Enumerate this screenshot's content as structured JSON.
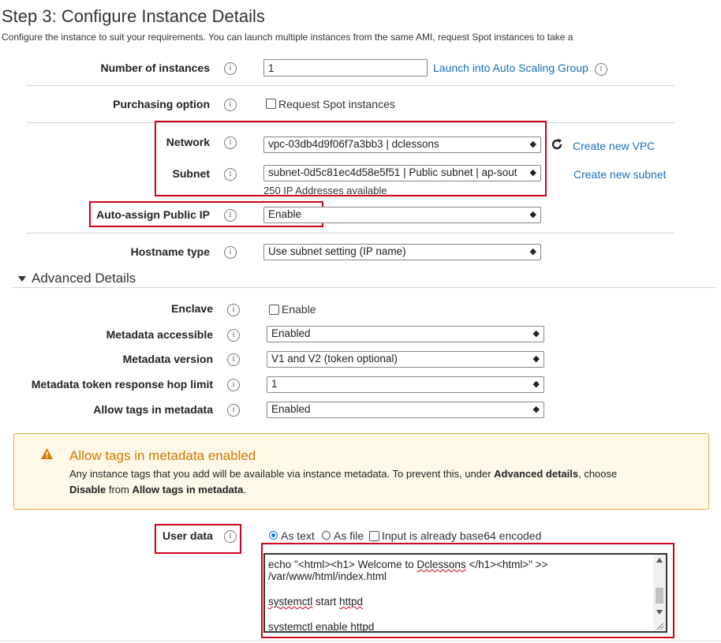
{
  "page": {
    "title": "Step 3: Configure Instance Details",
    "subtitle": "Configure the instance to suit your requirements. You can launch multiple instances from the same AMI, request Spot instances to take a"
  },
  "info_glyph": "i",
  "select_arrow_glyph": "◆",
  "fields": {
    "number_of_instances": {
      "label": "Number of instances",
      "value": "1",
      "link": "Launch into Auto Scaling Group"
    },
    "purchasing_option": {
      "label": "Purchasing option",
      "checkbox_label": "Request Spot instances"
    },
    "network": {
      "label": "Network",
      "value": "vpc-03db4d9f06f7a3bb3 | dclessons",
      "link": "Create new VPC"
    },
    "subnet": {
      "label": "Subnet",
      "value": "subnet-0d5c81ec4d58e5f51 | Public subnet | ap-sout",
      "link": "Create new subnet",
      "note": "250 IP Addresses available"
    },
    "auto_assign_public_ip": {
      "label": "Auto-assign Public IP",
      "value": "Enable"
    },
    "hostname_type": {
      "label": "Hostname type",
      "value": "Use subnet setting (IP name)"
    }
  },
  "advanced": {
    "heading": "Advanced Details",
    "enclave": {
      "label": "Enclave",
      "checkbox_label": "Enable"
    },
    "metadata_accessible": {
      "label": "Metadata accessible",
      "value": "Enabled"
    },
    "metadata_version": {
      "label": "Metadata version",
      "value": "V1 and V2 (token optional)"
    },
    "metadata_hop_limit": {
      "label": "Metadata token response hop limit",
      "value": "1"
    },
    "allow_tags": {
      "label": "Allow tags in metadata",
      "value": "Enabled"
    }
  },
  "warning": {
    "title": "Allow tags in metadata enabled",
    "line1_a": "Any instance tags that you add will be available via instance metadata. To prevent this, under ",
    "line1_b": "Advanced details",
    "line1_c": ", choose",
    "line2_a": "Disable",
    "line2_b": " from ",
    "line2_c": "Allow tags in metadata",
    "line2_d": "."
  },
  "user_data": {
    "label": "User data",
    "radio_text": "As text",
    "radio_file": "As file",
    "checkbox_base64": "Input is already base64 encoded",
    "line1_a": "echo \"<html><h1> Welcome to ",
    "line1_b": "Dclessons",
    "line1_c": " </h1><html>\" >>",
    "line2": "/var/www/html/index.html",
    "line3_a": "systemctl",
    "line3_b": " start ",
    "line3_c": "httpd",
    "line4_a": "systemctl",
    "line4_b": " enable ",
    "line4_c": "httpd"
  },
  "colors": {
    "link": "#1a6fb8",
    "highlight": "#d0021b",
    "warning_title": "#d47800",
    "warning_bg": "#fef8e8"
  }
}
